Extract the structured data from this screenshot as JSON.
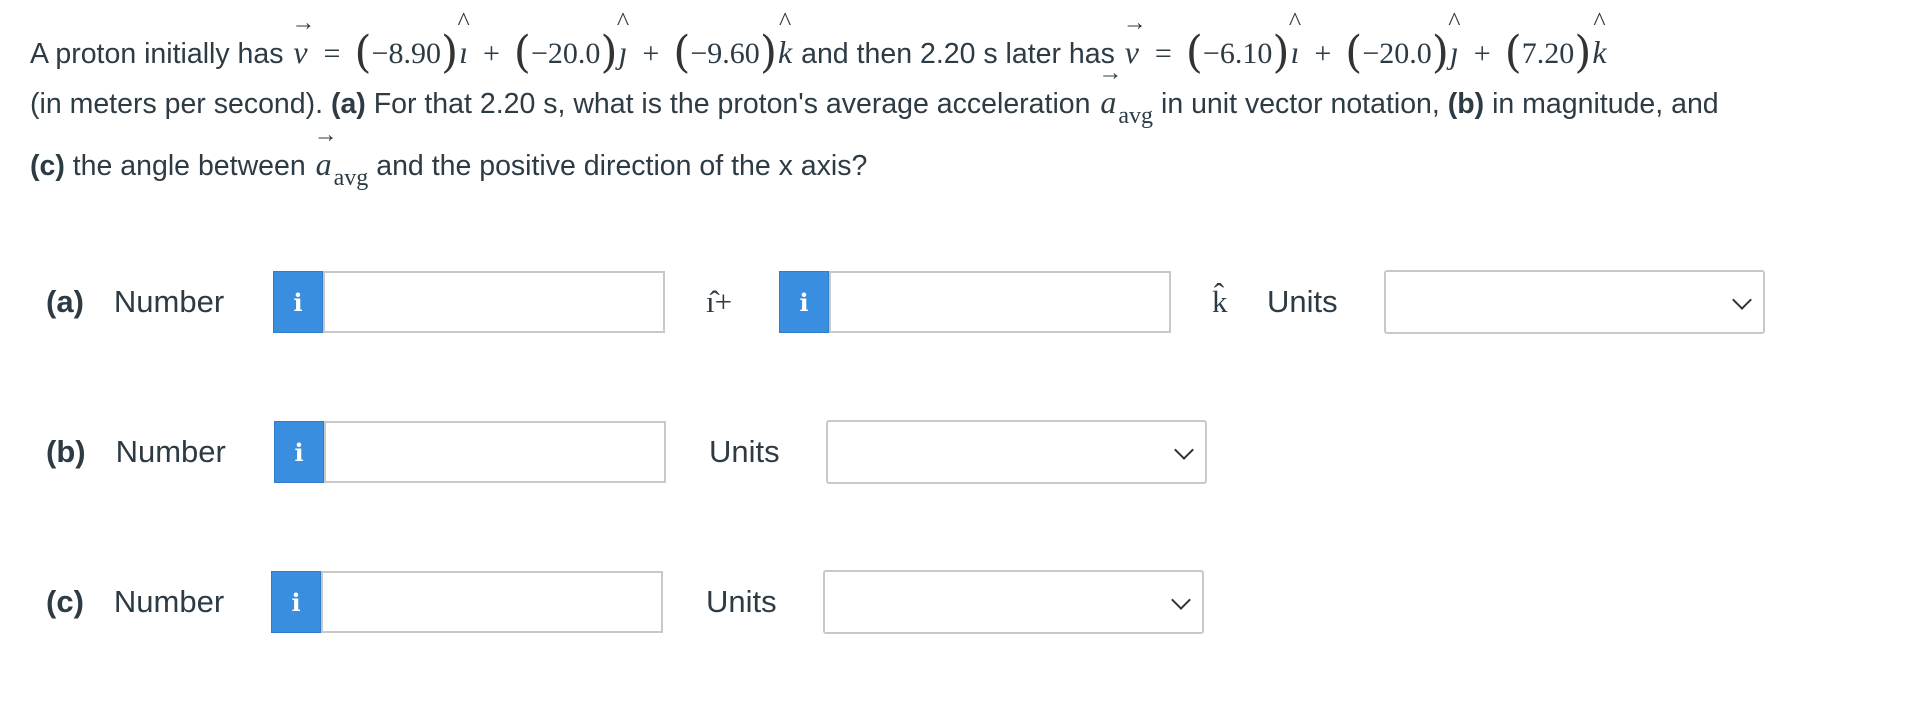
{
  "question": {
    "line1": {
      "intro": "A proton initially has",
      "eq": "=",
      "v_symbol": "v",
      "v1_x": "−8.90",
      "v1_y": "−20.0",
      "v1_z": "−9.60",
      "mid": "and then 2.20 s later has",
      "v2_x": "−6.10",
      "v2_y": "−20.0",
      "v2_z": "7.20",
      "i_hat": "ı",
      "j_hat": "ȷ",
      "k_hat": "k",
      "plus": "+"
    },
    "line2": {
      "units_text": "(in meters per second).",
      "part_a_label": "(a)",
      "part_a_text": "For that 2.20 s, what is the proton's average acceleration",
      "a_symbol": "a",
      "avg_sub": "avg",
      "part_a_tail": "in unit vector notation,",
      "part_b_label": "(b)",
      "part_b_text": "in magnitude, and"
    },
    "line3": {
      "part_c_label": "(c)",
      "part_c_text": "the angle between",
      "a_symbol": "a",
      "avg_sub": "avg",
      "part_c_tail": "and the positive direction of the x axis?"
    }
  },
  "answers": {
    "a": {
      "label": "(a)",
      "number_label": "Number",
      "info_icon": "i",
      "i_hat_plus": "ı̂+",
      "k_hat": "k̂",
      "units_label": "Units",
      "input1_value": "",
      "input2_value": "",
      "units_value": ""
    },
    "b": {
      "label": "(b)",
      "number_label": "Number",
      "info_icon": "i",
      "units_label": "Units",
      "input_value": "",
      "units_value": ""
    },
    "c": {
      "label": "(c)",
      "number_label": "Number",
      "info_icon": "i",
      "units_label": "Units",
      "input_value": "",
      "units_value": ""
    }
  },
  "colors": {
    "info_button": "#3a8ee0",
    "text": "#2d3b45",
    "input_border": "#c8c8c8"
  }
}
